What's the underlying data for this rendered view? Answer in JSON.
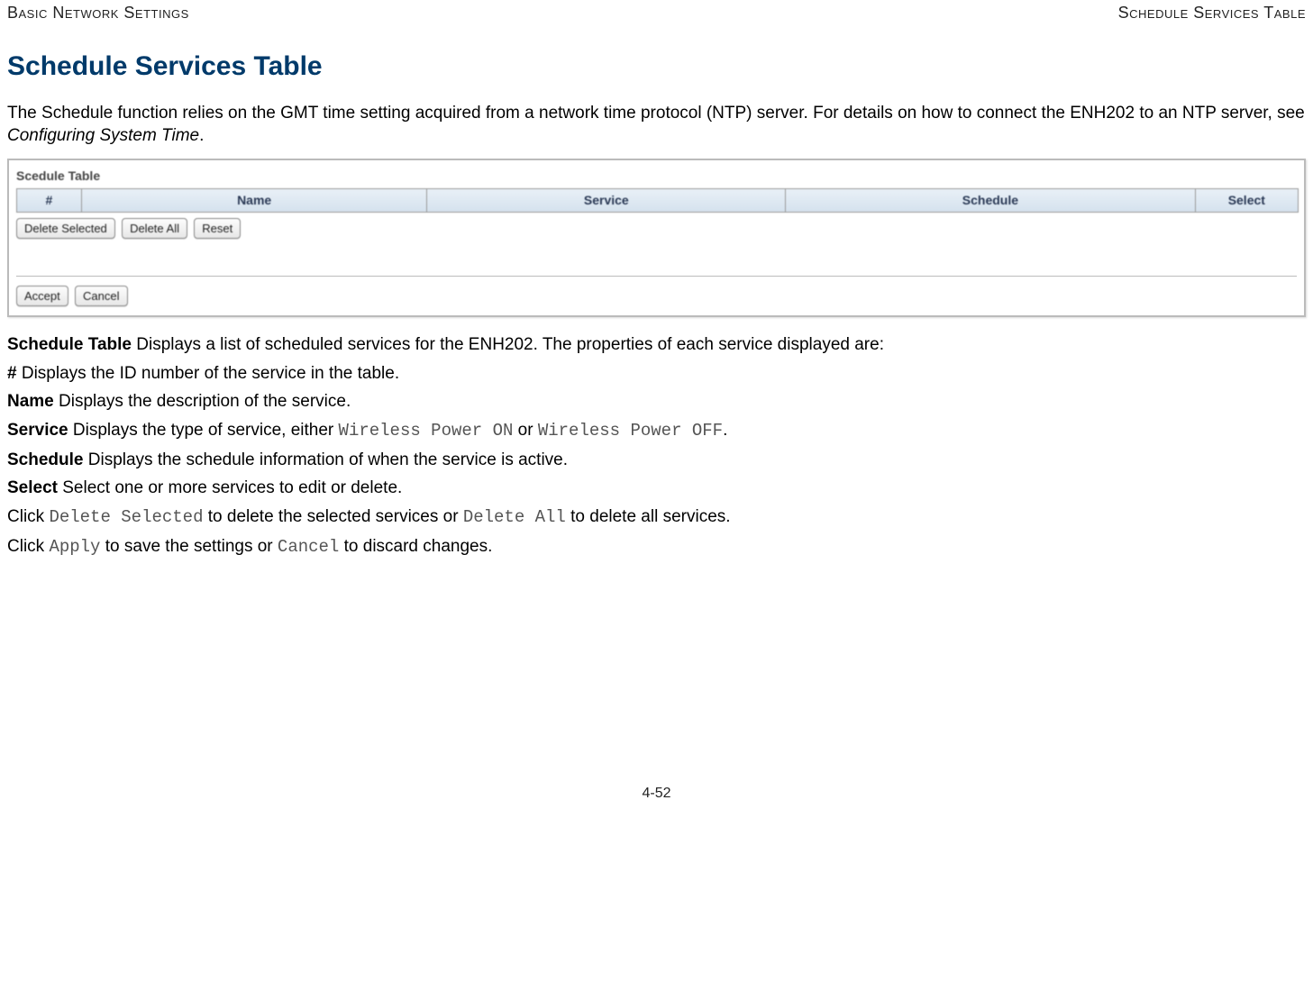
{
  "header": {
    "left": "Basic Network Settings",
    "right": "Schedule Services Table"
  },
  "title": "Schedule Services Table",
  "intro": {
    "text_a": "The Schedule function relies on the GMT time setting acquired from a network time protocol (NTP) server. For details on how to connect the ENH202 to an NTP server, see ",
    "link": "Configuring System Time",
    "text_b": "."
  },
  "screenshot": {
    "caption": "Scedule Table",
    "cols": {
      "num": "#",
      "name": "Name",
      "service": "Service",
      "schedule": "Schedule",
      "select": "Select"
    },
    "buttons_top": {
      "delete_selected": "Delete Selected",
      "delete_all": "Delete All",
      "reset": "Reset"
    },
    "buttons_bottom": {
      "accept": "Accept",
      "cancel": "Cancel"
    }
  },
  "defs": {
    "schedule_table": {
      "label": "Schedule Table",
      "desc": " Displays a list of scheduled services for the ENH202. The properties of each service displayed are:"
    },
    "num": {
      "label": "#",
      "desc": " Displays the ID number of the service in the table."
    },
    "name": {
      "label": "Name",
      "desc": " Displays the description of the service."
    },
    "service": {
      "label": "Service",
      "desc_a": " Displays the type of service, either ",
      "code_a": "Wireless Power ON",
      "mid": " or ",
      "code_b": "Wireless Power OFF",
      "tail": "."
    },
    "schedule": {
      "label": "Schedule",
      "desc": " Displays the schedule information of when the service is active."
    },
    "select": {
      "label": "Select",
      "desc": "  Select one or more services to edit or delete."
    },
    "click1": {
      "pre": "Click ",
      "code_a": "Delete Selected",
      "mid": " to delete the selected services or ",
      "code_b": "Delete All",
      "tail": " to delete all services."
    },
    "click2": {
      "pre": "Click ",
      "code_a": "Apply",
      "mid": " to save the settings or ",
      "code_b": "Cancel",
      "tail": " to discard changes."
    }
  },
  "page_number": "4-52"
}
